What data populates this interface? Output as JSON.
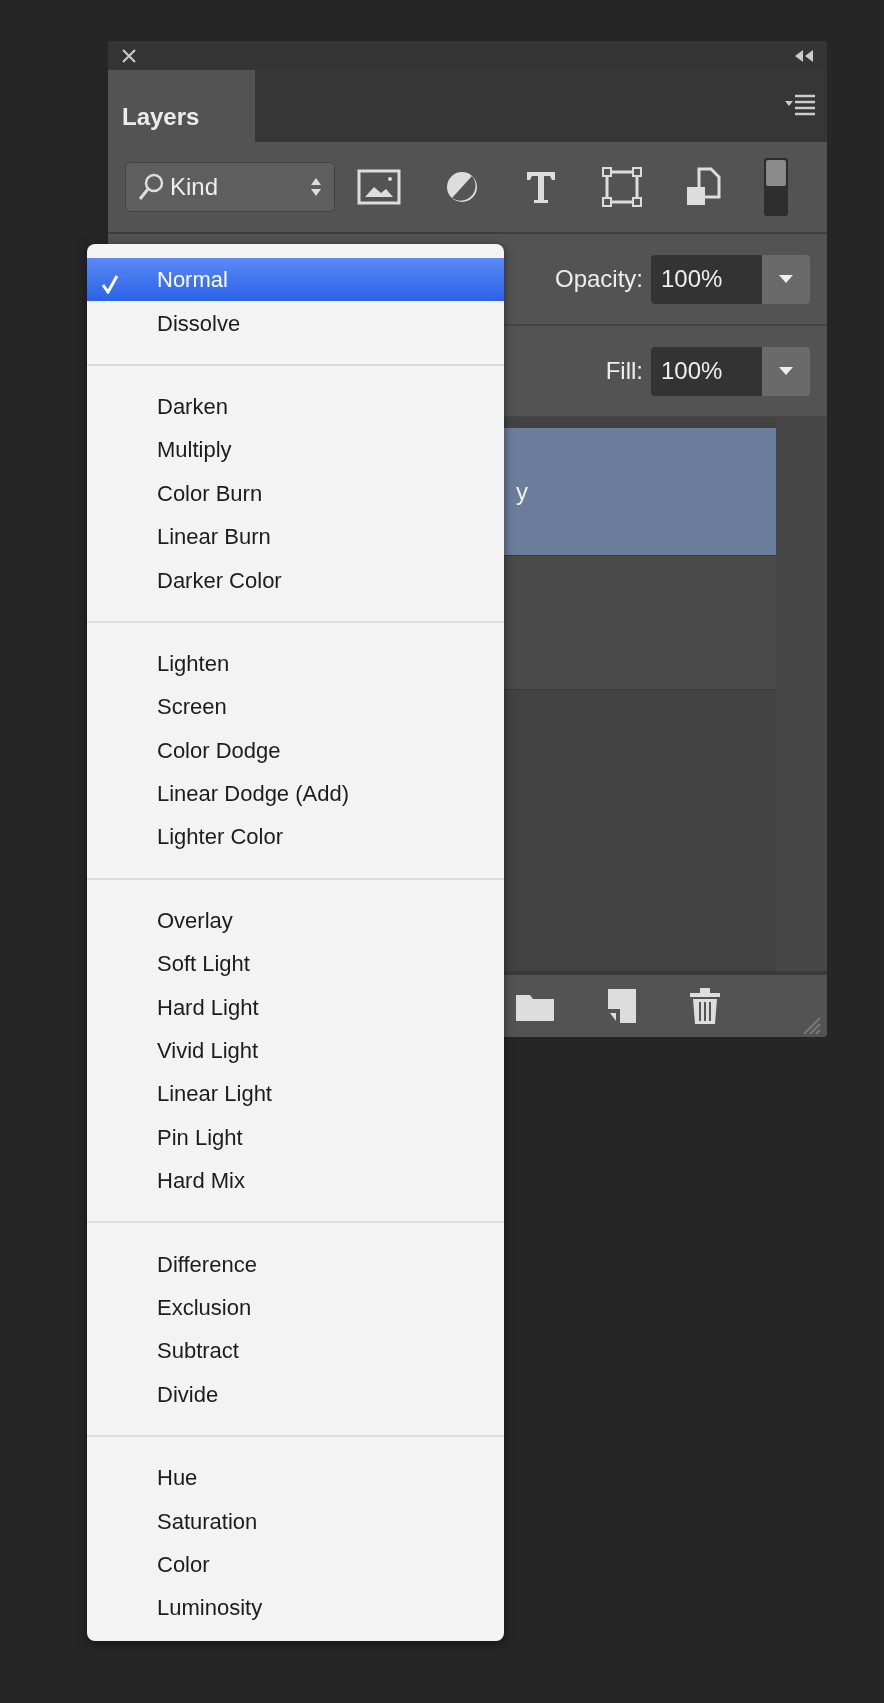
{
  "panel": {
    "tabs": [
      {
        "label": "Layers",
        "selected": true
      }
    ],
    "filter": {
      "value": "Kind"
    },
    "opacity": {
      "label": "Opacity:",
      "value": "100%"
    },
    "fill": {
      "label": "Fill:",
      "value": "100%"
    },
    "layers": [
      {
        "name": "y",
        "selected": true
      },
      {
        "selected": false
      }
    ]
  },
  "blend_menu": {
    "groups": [
      {
        "items": [
          {
            "label": "Normal",
            "selected": true
          },
          {
            "label": "Dissolve",
            "selected": false
          }
        ]
      },
      {
        "items": [
          {
            "label": "Darken",
            "selected": false
          },
          {
            "label": "Multiply",
            "selected": false
          },
          {
            "label": "Color Burn",
            "selected": false
          },
          {
            "label": "Linear Burn",
            "selected": false
          },
          {
            "label": "Darker Color",
            "selected": false
          }
        ]
      },
      {
        "items": [
          {
            "label": "Lighten",
            "selected": false
          },
          {
            "label": "Screen",
            "selected": false
          },
          {
            "label": "Color Dodge",
            "selected": false
          },
          {
            "label": "Linear Dodge (Add)",
            "selected": false
          },
          {
            "label": "Lighter Color",
            "selected": false
          }
        ]
      },
      {
        "items": [
          {
            "label": "Overlay",
            "selected": false
          },
          {
            "label": "Soft Light",
            "selected": false
          },
          {
            "label": "Hard Light",
            "selected": false
          },
          {
            "label": "Vivid Light",
            "selected": false
          },
          {
            "label": "Linear Light",
            "selected": false
          },
          {
            "label": "Pin Light",
            "selected": false
          },
          {
            "label": "Hard Mix",
            "selected": false
          }
        ]
      },
      {
        "items": [
          {
            "label": "Difference",
            "selected": false
          },
          {
            "label": "Exclusion",
            "selected": false
          },
          {
            "label": "Subtract",
            "selected": false
          },
          {
            "label": "Divide",
            "selected": false
          }
        ]
      },
      {
        "items": [
          {
            "label": "Hue",
            "selected": false
          },
          {
            "label": "Saturation",
            "selected": false
          },
          {
            "label": "Color",
            "selected": false
          },
          {
            "label": "Luminosity",
            "selected": false
          }
        ]
      }
    ]
  }
}
